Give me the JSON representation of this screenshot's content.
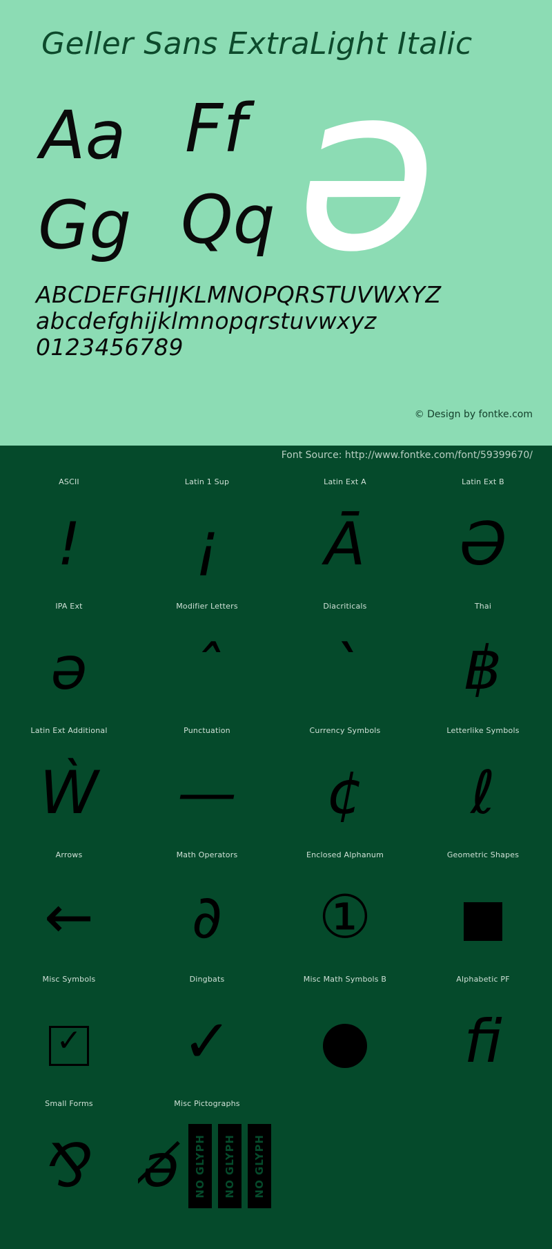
{
  "hero": {
    "title": "Geller Sans ExtraLight Italic",
    "specimen_pairs": [
      "Aa",
      "Ff",
      "Gg",
      "Qq"
    ],
    "specimen_big_glyph": "ə",
    "alphabet_uppercase": "ABCDEFGHIJKLMNOPQRSTUVWXYZ",
    "alphabet_lowercase": "abcdefghijklmnopqrstuvwxyz",
    "digits": "0123456789",
    "copyright": "© Design by fontke.com",
    "background_color": "#8cdcb4",
    "title_color": "#0d4a2c",
    "big_glyph_color": "#ffffff"
  },
  "source_bar": {
    "label": "Font Source: http://www.fontke.com/font/59399670/",
    "background_color": "#054a2b",
    "text_color": "#b9cfc3"
  },
  "glyph_grid": {
    "background_color": "#054a2b",
    "label_color": "#cfe0d6",
    "glyph_color": "#000000",
    "rows": [
      {
        "cells": [
          {
            "label": "ASCII",
            "glyph": "!",
            "kind": "text"
          },
          {
            "label": "Latin 1 Sup",
            "glyph": "¡",
            "kind": "text"
          },
          {
            "label": "Latin Ext A",
            "glyph": "Ā",
            "kind": "text"
          },
          {
            "label": "Latin Ext B",
            "glyph": "Ə",
            "kind": "text"
          }
        ]
      },
      {
        "cells": [
          {
            "label": "IPA Ext",
            "glyph": "ə",
            "kind": "text"
          },
          {
            "label": "Modifier Letters",
            "glyph": "ˆ",
            "kind": "text"
          },
          {
            "label": "Diacriticals",
            "glyph": "`",
            "kind": "text"
          },
          {
            "label": "Thai",
            "glyph": "฿",
            "kind": "text"
          }
        ]
      },
      {
        "cells": [
          {
            "label": "Latin Ext Additional",
            "glyph": "Ẁ",
            "kind": "text"
          },
          {
            "label": "Punctuation",
            "glyph": "—",
            "kind": "text"
          },
          {
            "label": "Currency Symbols",
            "glyph": "¢",
            "kind": "text"
          },
          {
            "label": "Letterlike Symbols",
            "glyph": "ℓ",
            "kind": "text"
          }
        ]
      },
      {
        "cells": [
          {
            "label": "Arrows",
            "glyph": "←",
            "kind": "text"
          },
          {
            "label": "Math Operators",
            "glyph": "∂",
            "kind": "text"
          },
          {
            "label": "Enclosed Alphanum",
            "glyph": "①",
            "kind": "text"
          },
          {
            "label": "Geometric Shapes",
            "glyph": "■",
            "kind": "square"
          }
        ]
      },
      {
        "cells": [
          {
            "label": "Misc Symbols",
            "glyph": "☑",
            "kind": "boxcheck"
          },
          {
            "label": "Dingbats",
            "glyph": "✓",
            "kind": "text"
          },
          {
            "label": "Misc Math Symbols B",
            "glyph": "●",
            "kind": "circle"
          },
          {
            "label": "Alphabetic PF",
            "glyph": "ﬁ",
            "kind": "text"
          }
        ]
      },
      {
        "cells": [
          {
            "label": "Small Forms",
            "glyph": "⅋",
            "kind": "text"
          },
          {
            "label": "Misc Pictographs",
            "glyph": "ə̸",
            "kind": "noglyph3"
          },
          {
            "label": "",
            "glyph": "",
            "kind": "blank"
          },
          {
            "label": "",
            "glyph": "",
            "kind": "blank"
          }
        ]
      }
    ],
    "noglyph_label": "NO GLYPH",
    "noglyph_count": 3
  }
}
